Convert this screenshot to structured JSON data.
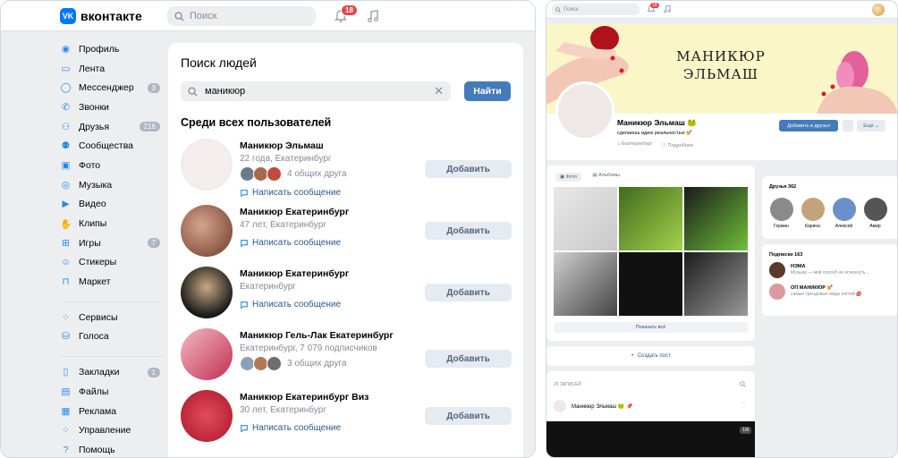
{
  "left": {
    "logo_text": "вконтакте",
    "logo_mark": "VK",
    "search_placeholder": "Поиск",
    "notifications_count": "18",
    "sidebar": [
      {
        "label": "Профиль",
        "icon": "profile-icon",
        "glyph": "◉"
      },
      {
        "label": "Лента",
        "icon": "feed-icon",
        "glyph": "▭"
      },
      {
        "label": "Мессенджер",
        "icon": "messenger-icon",
        "glyph": "◯",
        "count": "3"
      },
      {
        "label": "Звонки",
        "icon": "phone-icon",
        "glyph": "✆"
      },
      {
        "label": "Друзья",
        "icon": "friends-icon",
        "glyph": "⚇",
        "count": "216"
      },
      {
        "label": "Сообщества",
        "icon": "communities-icon",
        "glyph": "⚉"
      },
      {
        "label": "Фото",
        "icon": "photo-icon",
        "glyph": "▣"
      },
      {
        "label": "Музыка",
        "icon": "music-icon",
        "glyph": "◎"
      },
      {
        "label": "Видео",
        "icon": "video-icon",
        "glyph": "▶"
      },
      {
        "label": "Клипы",
        "icon": "clips-icon",
        "glyph": "✋"
      },
      {
        "label": "Игры",
        "icon": "games-icon",
        "glyph": "⊞",
        "count": "7"
      },
      {
        "label": "Стикеры",
        "icon": "stickers-icon",
        "glyph": "☺"
      },
      {
        "label": "Маркет",
        "icon": "market-icon",
        "glyph": "⊓"
      },
      {
        "separator": true
      },
      {
        "label": "Сервисы",
        "icon": "services-icon",
        "glyph": "⁘"
      },
      {
        "label": "Голоса",
        "icon": "votes-icon",
        "glyph": "⛁"
      },
      {
        "separator": true
      },
      {
        "label": "Закладки",
        "icon": "bookmarks-icon",
        "glyph": "▯",
        "count": "1"
      },
      {
        "label": "Файлы",
        "icon": "files-icon",
        "glyph": "▤"
      },
      {
        "label": "Реклама",
        "icon": "ads-icon",
        "glyph": "▦"
      },
      {
        "label": "Управление",
        "icon": "manage-icon",
        "glyph": "⁘"
      },
      {
        "label": "Помощь",
        "icon": "help-icon",
        "glyph": "?"
      }
    ],
    "page_title": "Поиск людей",
    "search_value": "маникюр",
    "find_button": "Найти",
    "subtitle": "Среди всех пользователей",
    "add_label": "Добавить",
    "write_label": "Написать сообщение",
    "people": [
      {
        "name": "Маникюр Эльмаш",
        "info": "22 года, Екатеринбург",
        "friends": "4 общих друга",
        "has_write": true
      },
      {
        "name": "Маникюр Екатеринбург",
        "info": "47 лет, Екатеринбург",
        "friends": "",
        "has_write": true
      },
      {
        "name": "Маникюр Екатеринбург",
        "info": "Екатеринбург",
        "friends": "",
        "has_write": true
      },
      {
        "name": "Маникюр Гель-Лак Екатеринбург",
        "info": "Екатеринбург, 7 079 подписчиков",
        "friends": "3 общих друга",
        "has_write": false
      },
      {
        "name": "Маникюр Екатеринбург Виз",
        "info": "30 лет, Екатеринбург",
        "friends": "",
        "has_write": true
      }
    ]
  },
  "right": {
    "search_placeholder": "Поиск",
    "notifications_count": "18",
    "cover_title_line1": "МАНИКЮР",
    "cover_title_line2": "ЭЛЬМАШ",
    "profile_name": "Маникюр Эльмаш 🐸",
    "status": "сделаешь идею реальностью 💅",
    "location": "Екатеринбург",
    "details": "Подробнее",
    "add_friend": "Добавить в друзья",
    "more": "Ещё ⌄",
    "photos_tab": "Фото",
    "albums_tab": "Альбомы",
    "show_all": "Показать всё",
    "create_post": "Создать пост",
    "posts_count": "25 ЗАПИСЕЙ",
    "post_author": "Маникюр Эльмаш 🐸 📌",
    "post_badge": "1/8",
    "friends_title": "Друзья 362",
    "friends": [
      {
        "name": "Герман",
        "color": "#8a8a8a"
      },
      {
        "name": "Карина",
        "color": "#c4a27a"
      },
      {
        "name": "Алексей",
        "color": "#6b8fc9"
      },
      {
        "name": "Амир",
        "color": "#555555"
      }
    ],
    "subs_title": "Подписки 163",
    "subs": [
      {
        "name": "НЭМА",
        "text": "Музыка — мой способ не исчезнуть...",
        "color": "#5a3a2a"
      },
      {
        "name": "ОП МАНИКЮР 💅",
        "text": "самые трендовые виды ногтей 💋",
        "color": "#d99aa0"
      }
    ]
  }
}
